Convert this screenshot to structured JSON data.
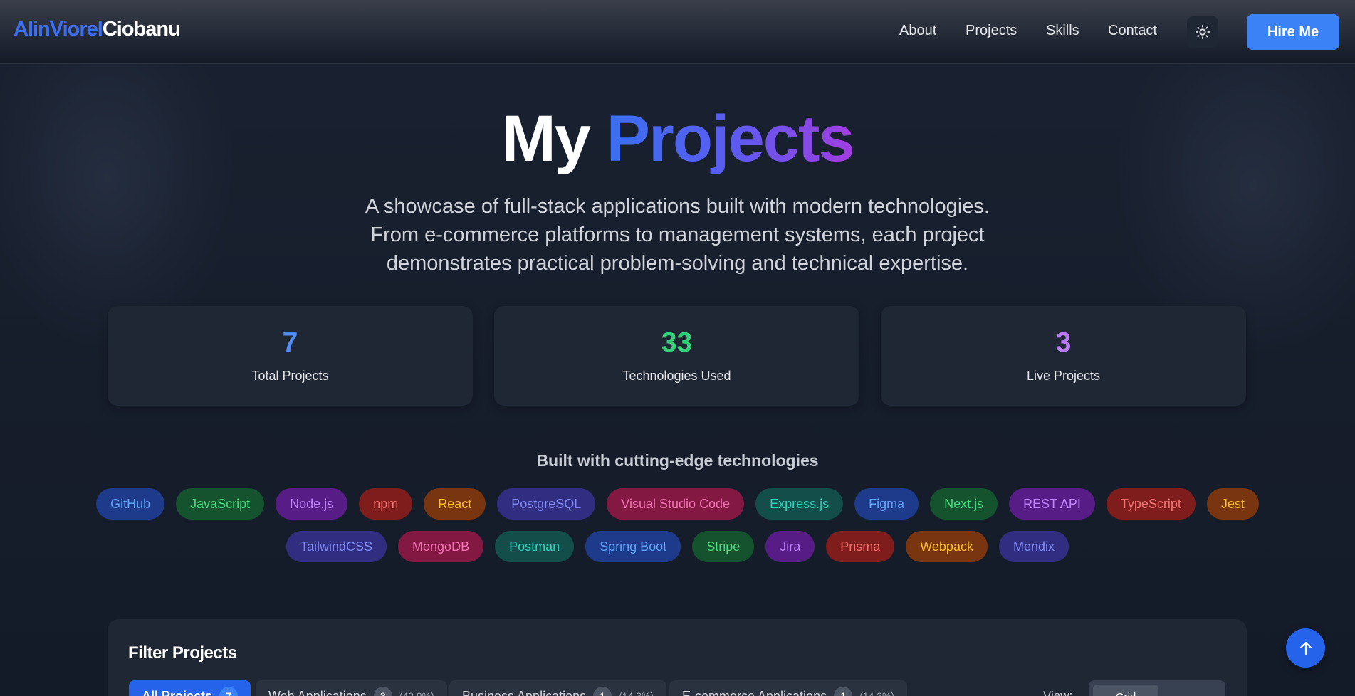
{
  "nav": {
    "logo_first": "AlinViorel",
    "logo_last": "Ciobanu",
    "links": [
      "About",
      "Projects",
      "Skills",
      "Contact"
    ],
    "theme_icon": "sun-icon",
    "hire_label": "Hire Me"
  },
  "hero": {
    "title_word1": "My",
    "title_word2": "Projects",
    "desc_line1": "A showcase of full-stack applications built with modern technologies.",
    "desc_line2": "From e-commerce platforms to management systems, each project",
    "desc_line3": "demonstrates practical problem-solving and technical expertise."
  },
  "stats": [
    {
      "value": "7",
      "label": "Total Projects",
      "color": "#4f8ef7"
    },
    {
      "value": "33",
      "label": "Technologies Used",
      "color": "#34d37a"
    },
    {
      "value": "3",
      "label": "Live Projects",
      "color": "#b97cf6"
    }
  ],
  "tech": {
    "heading": "Built with cutting-edge technologies",
    "row1": [
      {
        "label": "GitHub",
        "bg": "#1e3a8a",
        "fg": "#60a5fa"
      },
      {
        "label": "JavaScript",
        "bg": "#14532d",
        "fg": "#4ade80"
      },
      {
        "label": "Node.js",
        "bg": "#581c87",
        "fg": "#c084fc"
      },
      {
        "label": "npm",
        "bg": "#7f1d1d",
        "fg": "#f87171"
      },
      {
        "label": "React",
        "bg": "#78350f",
        "fg": "#fbbf24"
      },
      {
        "label": "PostgreSQL",
        "bg": "#312e81",
        "fg": "#818cf8"
      },
      {
        "label": "Visual Studio Code",
        "bg": "#831843",
        "fg": "#f472b6"
      },
      {
        "label": "Express.js",
        "bg": "#134e4a",
        "fg": "#2dd4bf"
      },
      {
        "label": "Figma",
        "bg": "#1e3a8a",
        "fg": "#60a5fa"
      },
      {
        "label": "Next.js",
        "bg": "#14532d",
        "fg": "#4ade80"
      },
      {
        "label": "REST API",
        "bg": "#581c87",
        "fg": "#c084fc"
      },
      {
        "label": "TypeScript",
        "bg": "#7f1d1d",
        "fg": "#f87171"
      },
      {
        "label": "Jest",
        "bg": "#78350f",
        "fg": "#fbbf24"
      }
    ],
    "row2": [
      {
        "label": "TailwindCSS",
        "bg": "#312e81",
        "fg": "#818cf8"
      },
      {
        "label": "MongoDB",
        "bg": "#831843",
        "fg": "#f472b6"
      },
      {
        "label": "Postman",
        "bg": "#134e4a",
        "fg": "#2dd4bf"
      },
      {
        "label": "Spring Boot",
        "bg": "#1e3a8a",
        "fg": "#60a5fa"
      },
      {
        "label": "Stripe",
        "bg": "#14532d",
        "fg": "#4ade80"
      },
      {
        "label": "Jira",
        "bg": "#581c87",
        "fg": "#c084fc"
      },
      {
        "label": "Prisma",
        "bg": "#7f1d1d",
        "fg": "#f87171"
      },
      {
        "label": "Webpack",
        "bg": "#78350f",
        "fg": "#fbbf24"
      },
      {
        "label": "Mendix",
        "bg": "#312e81",
        "fg": "#818cf8"
      }
    ]
  },
  "filter": {
    "title": "Filter Projects",
    "chips": [
      {
        "label": "All Projects",
        "count": "7",
        "pct": ""
      },
      {
        "label": "Web Applications",
        "count": "3",
        "pct": "(42.9%)"
      },
      {
        "label": "Business Applications",
        "count": "1",
        "pct": "(14.3%)"
      },
      {
        "label": "E-commerce Applications",
        "count": "1",
        "pct": "(14.3%)"
      }
    ],
    "view_label": "View:",
    "view_selected": "Grid"
  },
  "scroll_top_icon": "arrow-up-icon"
}
